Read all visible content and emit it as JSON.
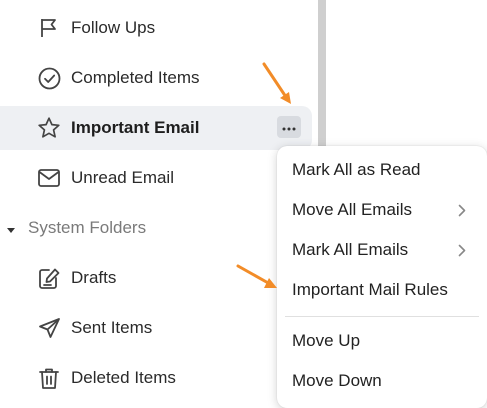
{
  "sidebar": {
    "items": [
      {
        "label": "Follow Ups",
        "icon": "flag-icon"
      },
      {
        "label": "Completed Items",
        "icon": "check-circle-icon"
      },
      {
        "label": "Important Email",
        "icon": "star-icon",
        "active": true
      },
      {
        "label": "Unread Email",
        "icon": "envelope-icon"
      }
    ],
    "section": {
      "label": "System Folders",
      "items": [
        {
          "label": "Drafts",
          "icon": "drafts-icon"
        },
        {
          "label": "Sent Items",
          "icon": "send-icon"
        },
        {
          "label": "Deleted Items",
          "icon": "trash-icon"
        }
      ]
    },
    "more_button_icon": "ellipsis-icon"
  },
  "context_menu": {
    "items": [
      {
        "label": "Mark All as Read",
        "submenu": false
      },
      {
        "label": "Move All Emails",
        "submenu": true
      },
      {
        "label": "Mark All Emails",
        "submenu": true
      },
      {
        "label": "Important Mail Rules",
        "submenu": false
      }
    ],
    "items_after_separator": [
      {
        "label": "Move Up",
        "submenu": false
      },
      {
        "label": "Move Down",
        "submenu": false
      }
    ]
  },
  "colors": {
    "accent_arrow": "#f28c28",
    "active_background": "#eef0f3",
    "icon": "#444444"
  }
}
